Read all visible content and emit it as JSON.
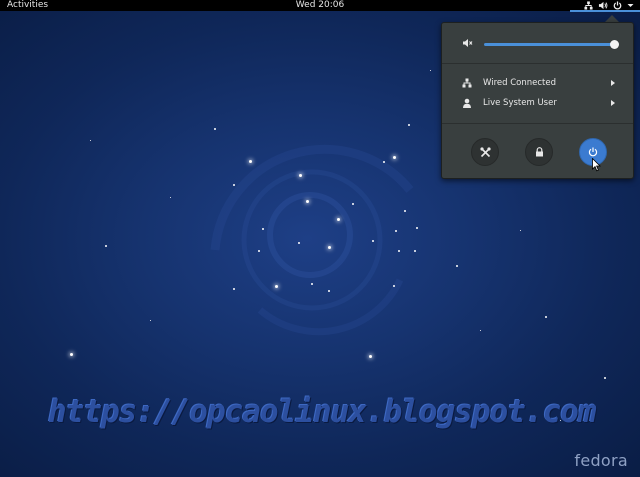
{
  "topbar": {
    "activities_label": "Activities",
    "clock": "Wed 20:06",
    "icons": [
      "network-wired-icon",
      "volume-icon",
      "power-icon",
      "menu-arrow-icon"
    ]
  },
  "system_menu": {
    "volume": {
      "icon": "speaker-muted-icon",
      "level_fraction": 1.0
    },
    "items": [
      {
        "label": "Wired Connected",
        "icon": "network-wired-icon",
        "has_submenu": true
      },
      {
        "label": "Live System User",
        "icon": "user-icon",
        "has_submenu": true
      }
    ],
    "actions": [
      {
        "name": "settings",
        "icon": "settings-tools-icon"
      },
      {
        "name": "lock",
        "icon": "lock-icon"
      },
      {
        "name": "power",
        "icon": "power-icon",
        "highlighted": true
      }
    ]
  },
  "desktop": {
    "watermark_text": "https://opcaolinux.blogspot.com",
    "brand_text": "fedora"
  },
  "colors": {
    "accent": "#4a90d9",
    "panel": "#393f3f",
    "topbar": "#000000",
    "desktop_bg": "#16336f"
  }
}
